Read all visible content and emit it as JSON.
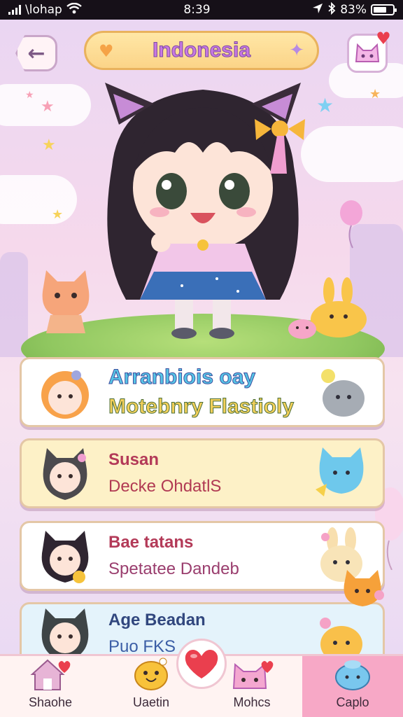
{
  "status_bar": {
    "carrier": "\\lohap",
    "time": "8:39",
    "battery_percent": "83%"
  },
  "header": {
    "title": "Indonesia",
    "back_icon": "arrow-left-icon",
    "profile_icon": "cat-avatar-icon"
  },
  "cards": [
    {
      "line1": "Arranbiois oay",
      "line2": "Motebnry Flastioly"
    },
    {
      "line1": "Susan",
      "line2": "Decke OhdatlS"
    },
    {
      "line1": "Bae tatans",
      "line2": "Spetatee Dandeb"
    },
    {
      "line1": "Age Beadan",
      "line2": "Puo FKS"
    }
  ],
  "tabs": [
    {
      "label": "Shaohe",
      "icon": "house-heart-icon"
    },
    {
      "label": "Uaetin",
      "icon": "smiley-blob-icon"
    },
    {
      "label": "Mohcs",
      "icon": "cat-heart-icon"
    },
    {
      "label": "Caplo",
      "icon": "blue-blob-icon",
      "active": true
    }
  ],
  "colors": {
    "accent_pink": "#f7a8c6",
    "title_purple": "#c878e2",
    "heart_red": "#ea3f4e"
  }
}
